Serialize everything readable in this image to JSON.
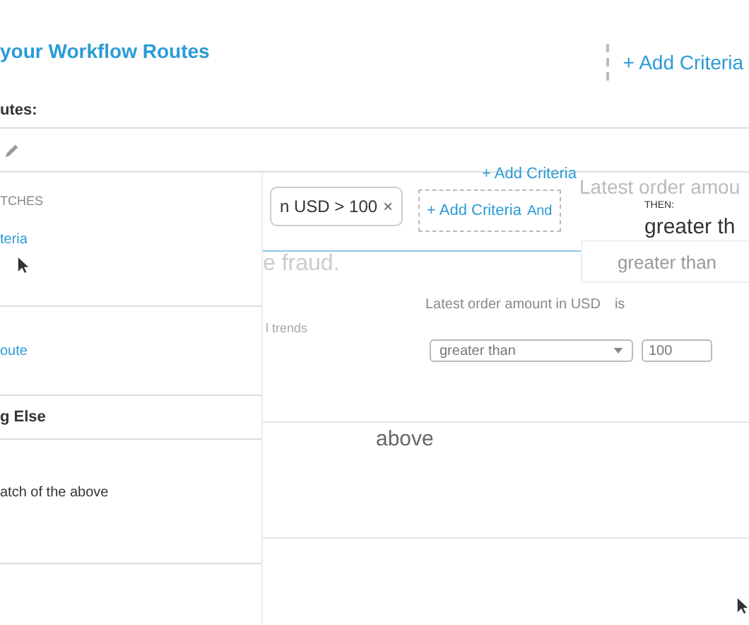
{
  "header": {
    "title": "your Workflow Routes",
    "add_criteria": "+ Add Criteria"
  },
  "routes_label": "utes:",
  "section_label": "TCHES",
  "routes": [
    {
      "label": "teria",
      "kind": "link"
    },
    {
      "label": "oute",
      "kind": "link"
    },
    {
      "label": "g Else",
      "kind": "heading"
    },
    {
      "label": "atch of the above",
      "kind": "text"
    }
  ],
  "criteria_chip": {
    "label": "n USD > 100",
    "remove": "×"
  },
  "add_criteria_link": "+ Add Criteria",
  "add_criteria_box": {
    "label": "+ Add Criteria",
    "conjunction": "And"
  },
  "then": {
    "label": "THEN:",
    "ghost_title": "Latest order amou",
    "value": "greater th",
    "ghost_value": "greater than"
  },
  "ghost_texts": [
    "e fraud.",
    "l trends"
  ],
  "condition": {
    "field": "Latest order amount in USD",
    "verb": "is",
    "operator": "greater than",
    "amount": "100"
  },
  "footer_text": "above"
}
